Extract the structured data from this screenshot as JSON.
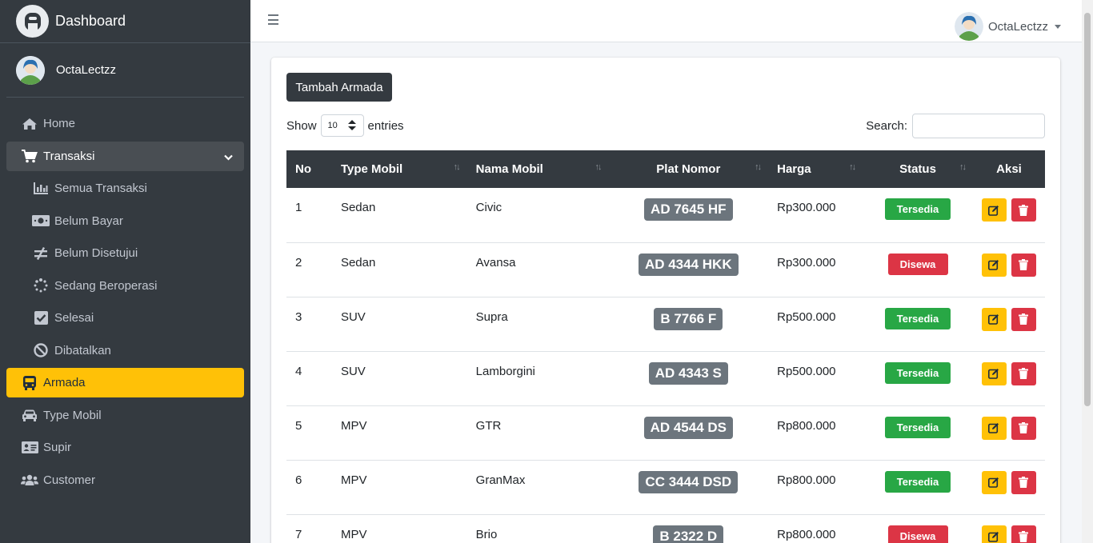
{
  "brand": {
    "title": "Dashboard"
  },
  "user": {
    "name": "OctaLectzz"
  },
  "sidebar": {
    "items": [
      {
        "label": "Home",
        "icon": "home-icon"
      },
      {
        "label": "Transaksi",
        "icon": "cart-icon"
      },
      {
        "label": "Semua Transaksi",
        "icon": "chart-icon"
      },
      {
        "label": "Belum Bayar",
        "icon": "money-icon"
      },
      {
        "label": "Belum Disetujui",
        "icon": "not-equal-icon"
      },
      {
        "label": "Sedang Beroperasi",
        "icon": "spinner-icon"
      },
      {
        "label": "Selesai",
        "icon": "check-square-icon"
      },
      {
        "label": "Dibatalkan",
        "icon": "ban-icon"
      },
      {
        "label": "Armada",
        "icon": "bus-icon"
      },
      {
        "label": "Type Mobil",
        "icon": "car-icon"
      },
      {
        "label": "Supir",
        "icon": "id-card-icon"
      },
      {
        "label": "Customer",
        "icon": "users-icon"
      }
    ]
  },
  "main": {
    "add_button": "Tambah Armada",
    "show_label": "Show",
    "entries_value": "10",
    "entries_label": "entries",
    "search_label": "Search:",
    "table": {
      "headers": [
        "No",
        "Type Mobil",
        "Nama Mobil",
        "Plat Nomor",
        "Harga",
        "Status",
        "Aksi"
      ],
      "rows": [
        {
          "no": "1",
          "type": "Sedan",
          "name": "Civic",
          "plate": "AD 7645 HF",
          "price": "Rp300.000",
          "status": "Tersedia"
        },
        {
          "no": "2",
          "type": "Sedan",
          "name": "Avansa",
          "plate": "AD 4344 HKK",
          "price": "Rp300.000",
          "status": "Disewa"
        },
        {
          "no": "3",
          "type": "SUV",
          "name": "Supra",
          "plate": "B 7766 F",
          "price": "Rp500.000",
          "status": "Tersedia"
        },
        {
          "no": "4",
          "type": "SUV",
          "name": "Lamborgini",
          "plate": "AD 4343 S",
          "price": "Rp500.000",
          "status": "Tersedia"
        },
        {
          "no": "5",
          "type": "MPV",
          "name": "GTR",
          "plate": "AD 4544 DS",
          "price": "Rp800.000",
          "status": "Tersedia"
        },
        {
          "no": "6",
          "type": "MPV",
          "name": "GranMax",
          "plate": "CC 3444 DSD",
          "price": "Rp800.000",
          "status": "Tersedia"
        },
        {
          "no": "7",
          "type": "MPV",
          "name": "Brio",
          "plate": "B 2322 D",
          "price": "Rp800.000",
          "status": "Disewa"
        }
      ]
    }
  },
  "colors": {
    "sidebar_bg": "#343a40",
    "active": "#ffc107",
    "available": "#28a745",
    "rented": "#dc3545",
    "plate": "#6c757d"
  }
}
